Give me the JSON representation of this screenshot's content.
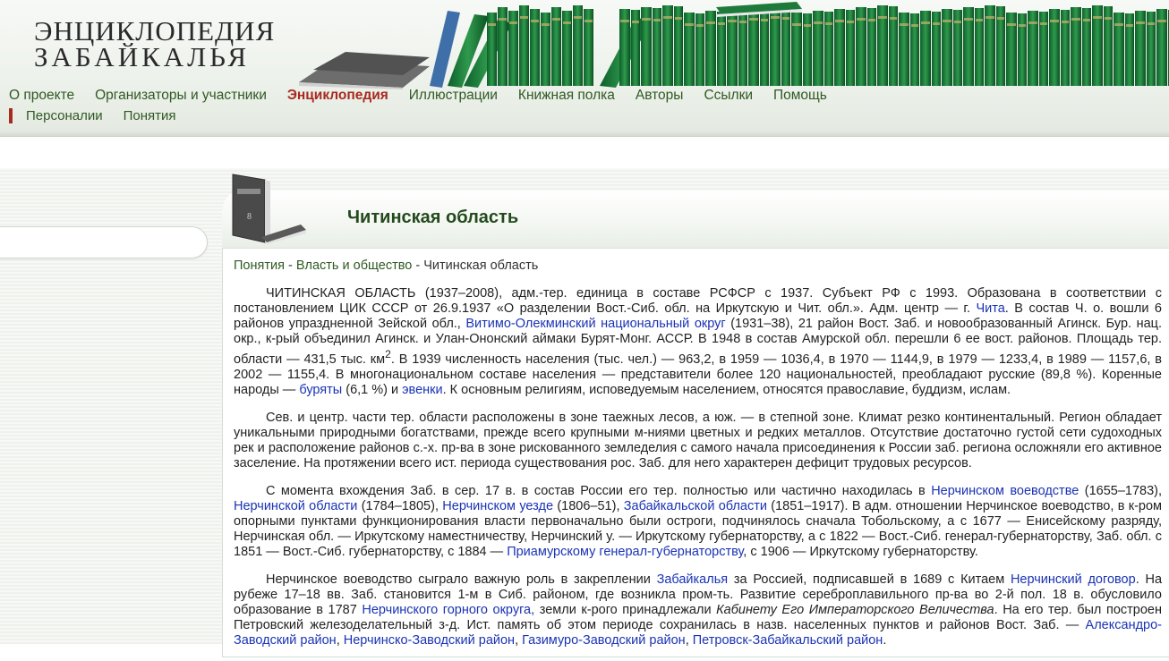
{
  "logo": {
    "line1": "ЭНЦИКЛОПЕДИЯ",
    "line2": "ЗАБАЙКАЛЬЯ"
  },
  "colors": {
    "nav_link": "#2f5a22",
    "nav_active": "#a8291f",
    "article_link": "#1a33b5",
    "title": "#234a1c"
  },
  "nav": {
    "items": [
      {
        "label": "О проекте",
        "active": false
      },
      {
        "label": "Организаторы и участники",
        "active": false
      },
      {
        "label": "Энциклопедия",
        "active": true
      },
      {
        "label": "Иллюстрации",
        "active": false
      },
      {
        "label": "Книжная полка",
        "active": false
      },
      {
        "label": "Авторы",
        "active": false
      },
      {
        "label": "Ссылки",
        "active": false
      },
      {
        "label": "Помощь",
        "active": false
      }
    ],
    "subitems": [
      {
        "label": "Персоналии"
      },
      {
        "label": "Понятия"
      }
    ]
  },
  "page": {
    "title": "Читинская область",
    "book_icon": "book-icon"
  },
  "breadcrumb": {
    "items": [
      "Понятия",
      "Власть и общество"
    ],
    "current": "Читинская область",
    "separator": " - "
  },
  "article": {
    "p1": {
      "t1": "ЧИТИНСКАЯ ОБЛАСТЬ (1937–2008), адм.-тер. единица в составе РСФСР с 1937. Субъект РФ с 1993. Образована в соответствии с постановлением ЦИК СССР от 26.9.1937 «О разделении Вост.-Сиб. обл. на Иркутскую и Чит. обл.». Адм. центр — г. ",
      "l1": "Чита",
      "t2": ". В состав Ч. о. вошли 6 районов упраздненной Зейской обл., ",
      "l2": "Витимо-Олекминский национальный округ",
      "t3": " (1931–38), 21 район Вост. Заб. и новообразованный Агинск. Бур. нац. окр., к-рый объединил Агинск. и Улан-Ононский аймаки Бурят-Монг. АССР. В 1948 в состав Амурской обл. перешли 6 ее вост. районов. Площадь тер. области — 431,5 тыс. км",
      "sup": "2",
      "t4": ". В 1939 численность населения (тыс. чел.) — 963,2, в 1959 — 1036,4, в 1970 — 1144,9, в 1979 — 1233,4, в 1989 — 1157,6, в 2002 — 1155,4. В многонациональном составе населения — представители более 120 национальностей, преобладают русские (89,8 %). Коренные народы — ",
      "l3": "буряты",
      "t5": " (6,1 %) и ",
      "l4": "эвенки",
      "t6": ". К основным религиям, исповедуемым населением, относятся православие, буддизм, ислам."
    },
    "p2": {
      "t1": "Сев. и центр. части тер. области расположены в зоне таежных лесов, а юж. — в степной зоне. Климат резко континентальный. Регион обладает уникальными природными богатствами, прежде всего крупными м-ниями цветных и редких металлов. Отсутствие достаточно густой сети судоходных рек и расположение районов с.-х. пр-ва в зоне рискованного земледелия с самого начала присоединения к России заб. региона осложняли его активное заселение. На протяжении всего ист. периода существования рос. Заб. для него характерен дефицит трудовых ресурсов."
    },
    "p3": {
      "t1": "С момента вхождения Заб. в сер. 17 в. в состав России его тер. полностью или частично находилась в ",
      "l1": "Нерчинском воеводстве",
      "t2": " (1655–1783), ",
      "l2": "Нерчинской области",
      "t3": " (1784–1805), ",
      "l3": "Нерчинском уезде",
      "t4": " (1806–51), ",
      "l4": "Забайкальской области",
      "t5": " (1851–1917). В адм. отношении Нерчинское воеводство, в к-ром опорными пунктами функционирования власти первоначально были остроги, подчинялось сначала Тобольскому, а с 1677 — Енисейскому разряду, Нерчинская обл. — Иркутскому наместничеству, Нерчинский у. — Иркутскому губернаторству, а с 1822 — Вост.-Сиб. генерал-губернаторству, Заб. обл. с 1851 — Вост.-Сиб. губернаторству, с 1884 — ",
      "l5": "Приамурскому генерал-губернаторству",
      "t6": ", с 1906 — Иркутскому губернаторству."
    },
    "p4": {
      "t1": "Нерчинское воеводство сыграло важную роль в закреплении ",
      "l1": "Забайкалья",
      "t2": " за Россией, подписавшей в 1689 с Китаем ",
      "l2": "Нерчинский договор",
      "t3": ". На рубеже 17–18 вв. Заб. становится 1-м в Сиб. районом, где возникла пром-ть. Развитие сереброплавильного пр-ва во 2-й пол. 18 в. обусловило образование в 1787 ",
      "l3": "Нерчинского горного округа,",
      "t4": " земли к-рого принадлежали ",
      "em": "Кабинету Его Императорского Величества",
      "t5": ". На его тер. был построен Петровский железоделательный з-д. Ист. память об этом периоде сохранилась в назв. населенных пунктов и районов Вост. Заб. — ",
      "l4": "Александро-Заводский район",
      "t6": ", ",
      "l5": "Нерчинско-Заводский район",
      "t7": ", ",
      "l6": "Газимуро-Заводский район",
      "t8": ", ",
      "l7": "Петровск-Забайкальский район",
      "t9": "."
    }
  }
}
